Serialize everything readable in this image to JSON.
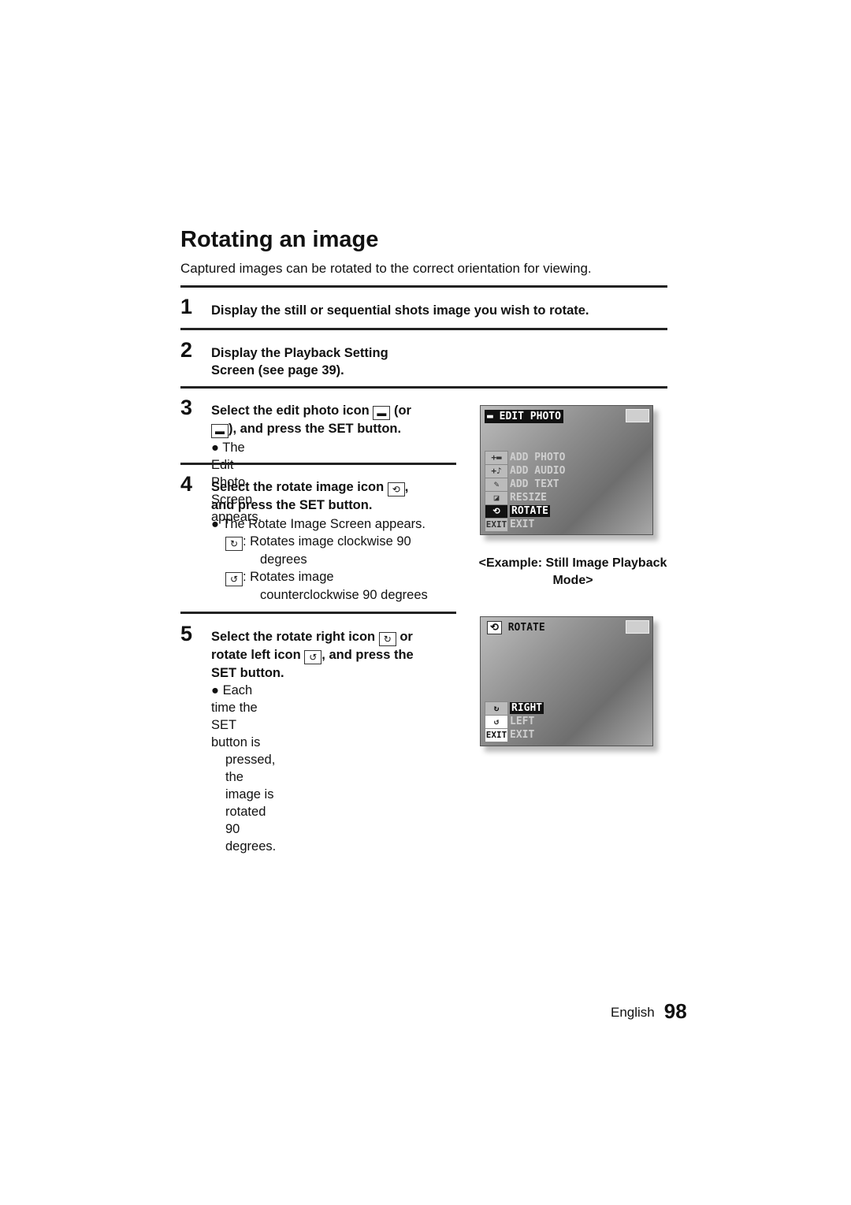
{
  "title": "Rotating an image",
  "intro": "Captured images can be rotated to the correct orientation for viewing.",
  "steps": [
    {
      "num": "1",
      "head": "Display the still or sequential shots image you wish to rotate."
    },
    {
      "num": "2",
      "head1": "Display the Playback Setting",
      "head2": "Screen (see page 39)."
    },
    {
      "num": "3",
      "head1a": "Select the edit photo icon",
      "head1b": "(or",
      "head2": "), and press the SET button.",
      "bullet": "The Edit Photo Screen appears."
    },
    {
      "num": "4",
      "head1": "Select the rotate image icon",
      "head2": "and press the SET button.",
      "bullet": "The Rotate Image Screen appears.",
      "cw": "Rotates image clockwise 90",
      "cw2": "degrees",
      "ccw": "Rotates image",
      "ccw2": "counterclockwise 90 degrees"
    },
    {
      "num": "5",
      "head1a": "Select the rotate right icon",
      "head1b": "or",
      "head2a": "rotate left icon",
      "head2b": ", and press the",
      "head3": "SET button.",
      "bullet1": "Each time the SET button is",
      "bullet2": "pressed, the image is rotated 90",
      "bullet3": "degrees."
    }
  ],
  "screen1": {
    "title": "EDIT PHOTO",
    "items": [
      "ADD PHOTO",
      "ADD AUDIO",
      "ADD TEXT",
      "RESIZE",
      "ROTATE",
      "EXIT"
    ],
    "selected": "ROTATE"
  },
  "caption1": "<Example: Still Image Playback",
  "caption2": "Mode>",
  "screen2": {
    "title": "ROTATE",
    "items": [
      "RIGHT",
      "LEFT",
      "EXIT"
    ],
    "selected": "RIGHT"
  },
  "footer": {
    "lang": "English",
    "page": "98"
  }
}
